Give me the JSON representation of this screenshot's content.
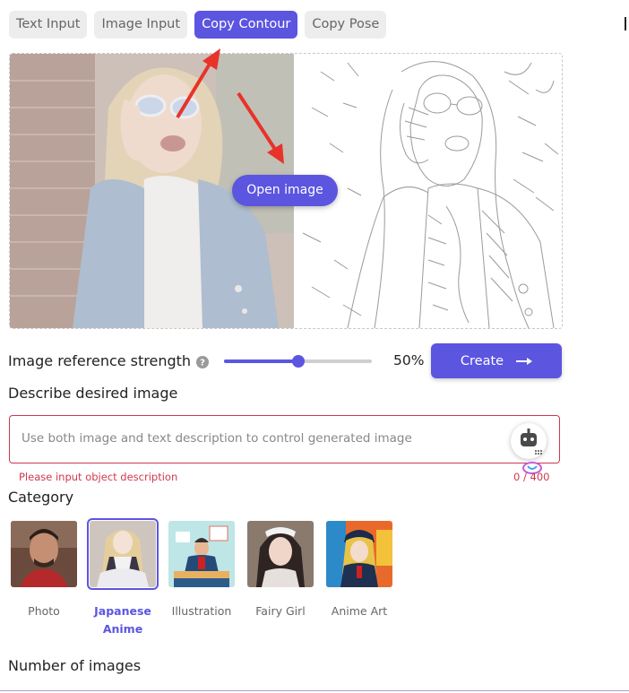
{
  "tabs": [
    {
      "label": "Text Input",
      "active": false
    },
    {
      "label": "Image Input",
      "active": false
    },
    {
      "label": "Copy Contour",
      "active": true
    },
    {
      "label": "Copy Pose",
      "active": false
    }
  ],
  "preview": {
    "open_button_label": "Open image"
  },
  "strength": {
    "label": "Image reference strength",
    "value": 50,
    "value_text": "50%"
  },
  "create_button_label": "Create",
  "describe": {
    "label": "Describe desired image",
    "placeholder": "Use both image and text description to control generated image",
    "value": "",
    "error": "Please input object description",
    "counter": "0 / 400"
  },
  "category": {
    "label": "Category",
    "items": [
      {
        "name": "Photo",
        "selected": false
      },
      {
        "name": "Japanese Anime",
        "selected": true
      },
      {
        "name": "Illustration",
        "selected": false
      },
      {
        "name": "Fairy Girl",
        "selected": false
      },
      {
        "name": "Anime Art",
        "selected": false
      }
    ]
  },
  "number_of_images_label": "Number of images",
  "colors": {
    "accent": "#5b55e0",
    "error": "#d0384f",
    "annotation_arrow": "#e8332a"
  }
}
